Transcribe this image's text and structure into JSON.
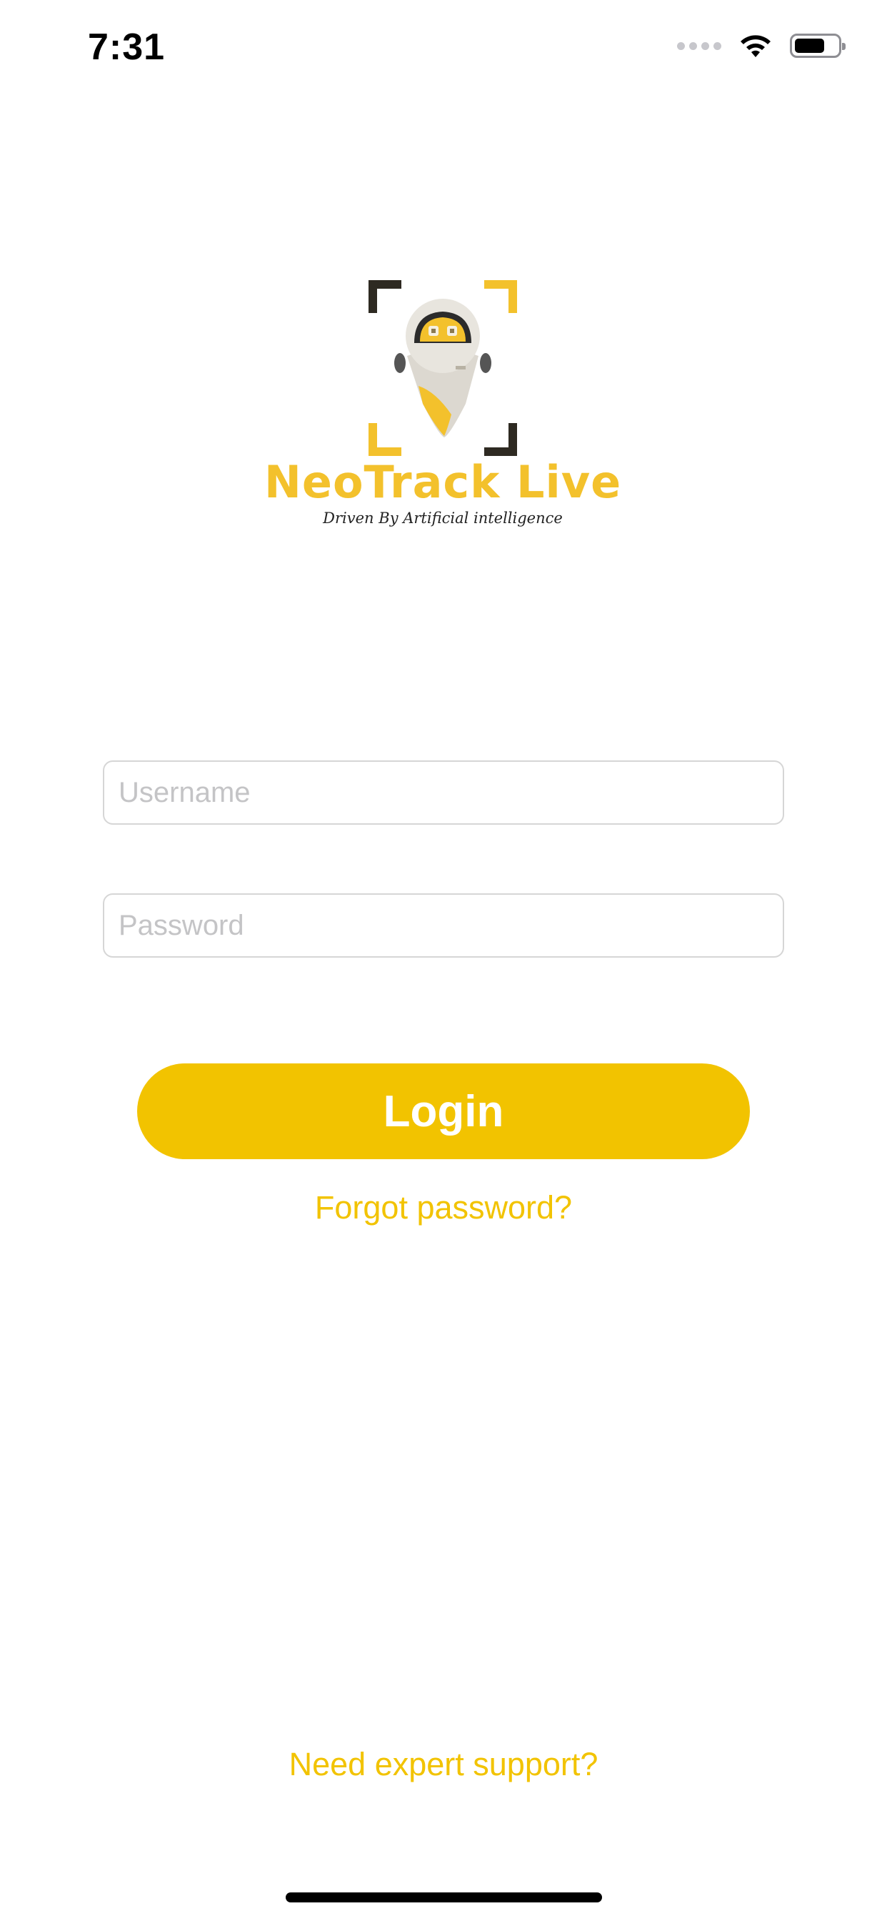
{
  "status_bar": {
    "time": "7:31",
    "battery_level": 0.7
  },
  "logo": {
    "title": "NeoTrack Live",
    "tagline": "Driven By Artificial intelligence",
    "icon": "robot-logo-icon"
  },
  "form": {
    "username_placeholder": "Username",
    "username_value": "",
    "password_placeholder": "Password",
    "password_value": ""
  },
  "actions": {
    "login_label": "Login",
    "forgot_password_label": "Forgot password?",
    "support_label": "Need expert support?"
  },
  "colors": {
    "accent": "#f2c300",
    "logo_yellow": "#f3c12c",
    "logo_dark": "#2e2a22",
    "input_border": "#d6d6d6",
    "placeholder": "#c4c4c6"
  }
}
